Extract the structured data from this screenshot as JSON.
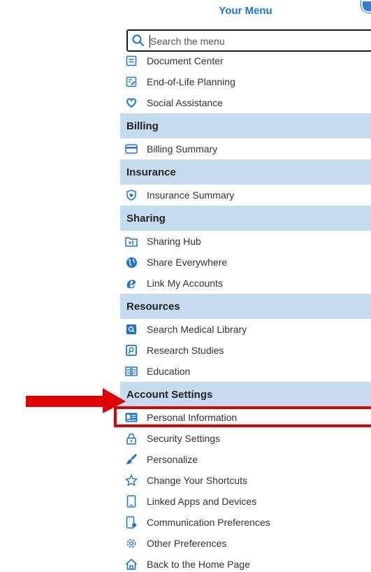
{
  "header": {
    "title": "Your Menu"
  },
  "search": {
    "placeholder": "Search the menu"
  },
  "colors": {
    "accent": "#1a73d9",
    "section_bg": "#c5dcf0",
    "annotation_red": "#e00000"
  },
  "menu": {
    "top_items": [
      {
        "label": "Document Center",
        "icon": "document-icon"
      },
      {
        "label": "End-of-Life Planning",
        "icon": "document-edit-icon"
      },
      {
        "label": "Social Assistance",
        "icon": "heart-hand-icon"
      }
    ],
    "sections": [
      {
        "title": "Billing",
        "items": [
          {
            "label": "Billing Summary",
            "icon": "credit-card-icon"
          }
        ]
      },
      {
        "title": "Insurance",
        "items": [
          {
            "label": "Insurance Summary",
            "icon": "shield-icon"
          }
        ]
      },
      {
        "title": "Sharing",
        "items": [
          {
            "label": "Sharing Hub",
            "icon": "sharing-hub-icon"
          },
          {
            "label": "Share Everywhere",
            "icon": "globe-icon"
          },
          {
            "label": "Link My Accounts",
            "icon": "link-e-icon"
          }
        ]
      },
      {
        "title": "Resources",
        "items": [
          {
            "label": "Search Medical Library",
            "icon": "library-search-icon"
          },
          {
            "label": "Research Studies",
            "icon": "research-icon"
          },
          {
            "label": "Education",
            "icon": "book-icon"
          }
        ]
      },
      {
        "title": "Account Settings",
        "items": [
          {
            "label": "Personal Information",
            "icon": "id-card-icon"
          },
          {
            "label": "Security Settings",
            "icon": "lock-icon"
          },
          {
            "label": "Personalize",
            "icon": "paintbrush-icon"
          },
          {
            "label": "Change Your Shortcuts",
            "icon": "star-icon"
          },
          {
            "label": "Linked Apps and Devices",
            "icon": "phone-icon"
          },
          {
            "label": "Communication Preferences",
            "icon": "phone-notification-icon"
          },
          {
            "label": "Other Preferences",
            "icon": "gear-icon"
          },
          {
            "label": "Back to the Home Page",
            "icon": "home-icon"
          }
        ]
      }
    ]
  }
}
